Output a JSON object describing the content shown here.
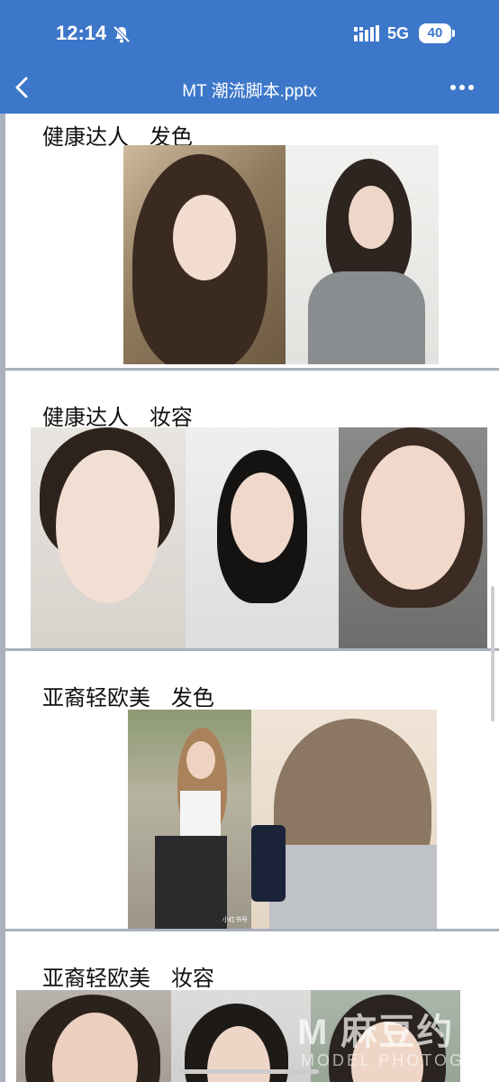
{
  "status": {
    "time": "12:14",
    "network": "5G",
    "battery": "40"
  },
  "header": {
    "title": "MT 潮流脚本.pptx"
  },
  "slides": [
    {
      "title": "健康达人   发色"
    },
    {
      "title": "健康达人   妆容"
    },
    {
      "title": "亚裔轻欧美   发色"
    },
    {
      "title": "亚裔轻欧美   妆容"
    }
  ],
  "photo_captions": {
    "small_caption": "小红书号"
  },
  "watermark": {
    "main": "M 麻豆约",
    "sub": "MODEL PHOTOGRA"
  },
  "colors": {
    "header": "#3c77ca",
    "separator": "#a9b0be",
    "slide_bg": "#ffffff"
  }
}
